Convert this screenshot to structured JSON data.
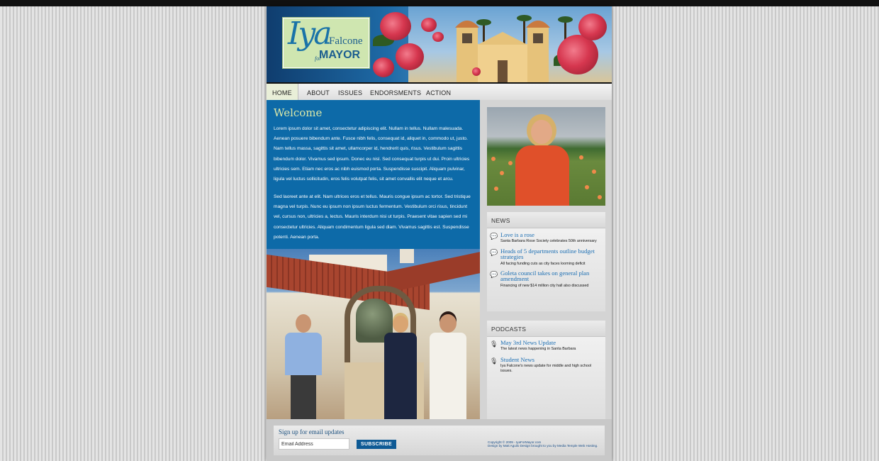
{
  "logo": {
    "iya": "Iya",
    "falcone": "Falcone",
    "for": "for",
    "mayor": "MAYOR"
  },
  "nav": {
    "items": [
      "HOME",
      "ABOUT",
      "ISSUES",
      "ENDORSMENTS",
      "ACTION"
    ],
    "active": "HOME"
  },
  "main": {
    "title": "Welcome",
    "paragraphs": [
      "Lorem ipsum dolor sit amet, consectetur adipiscing elit. Nullam in tellus. Nullam malesuada. Aenean posuere bibendum ante. Fusce nibh felis, consequat id, aliquet in, commodo ut, justo. Nam tellus massa, sagittis sit amet, ullamcorper id, hendrerit quis, risus. Vestibulum sagittis bibendum dolor. Vivamus sed ipsum. Donec eu nisl. Sed consequat turpis ut dui. Proin ultricies ultricies sem. Etiam nec eros ac nibh euismod porta. Suspendisse suscipit. Aliquam pulvinar, ligula vel luctus sollicitudin, eros felis volutpat felis, sit amet convallis elit neque et arcu.",
      "Sed laoreet ante at elit. Nam ultrices eros et tellus. Mauris congue ipsum ac tortor. Sed tristique magna vel turpis. Nunc eu ipsum non ipsum luctus fermentum. Vestibulum orci risus, tincidunt vel, cursus non, ultricies a, lectus. Mauris interdum nisi ut turpis. Praesent vitae sapien sed mi consectetur ultricies. Aliquam condimentum ligula sed diam. Vivamus sagittis est. Suspendisse potenti. Aenean porta."
    ]
  },
  "news": {
    "heading": "NEWS",
    "items": [
      {
        "title": "Love is a rose",
        "desc": "Santa Barbara Rose Society celebrates 50th anniversary"
      },
      {
        "title": "Heads of 5 departments outline budget strategies",
        "desc": "All facing funding cuts as city faces looming deficit"
      },
      {
        "title": "Goleta council takes on general plan amendment",
        "desc": "Financing of new $14 million city hall also discussed"
      }
    ]
  },
  "podcasts": {
    "heading": "PODCASTS",
    "items": [
      {
        "title": "May 3rd News Update",
        "desc": "The latest news happening in Santa Barbara"
      },
      {
        "title": "Student News",
        "desc": "Iya Falcone's news update for middle and high school issues."
      }
    ]
  },
  "footer": {
    "signup_label": "Sign up for email updates",
    "email_value": "Email Address",
    "subscribe_label": "SUBSCRIBE",
    "copyright": "Copyright © 2009 - IyaForMayor.com",
    "credits": "Design by Matt Aguilo Design brought to you by Media Temple Web Hosting."
  },
  "colors": {
    "accent_blue": "#0d6aa8",
    "title_green": "#dbe9a8",
    "link_blue": "#1b6eb3"
  }
}
